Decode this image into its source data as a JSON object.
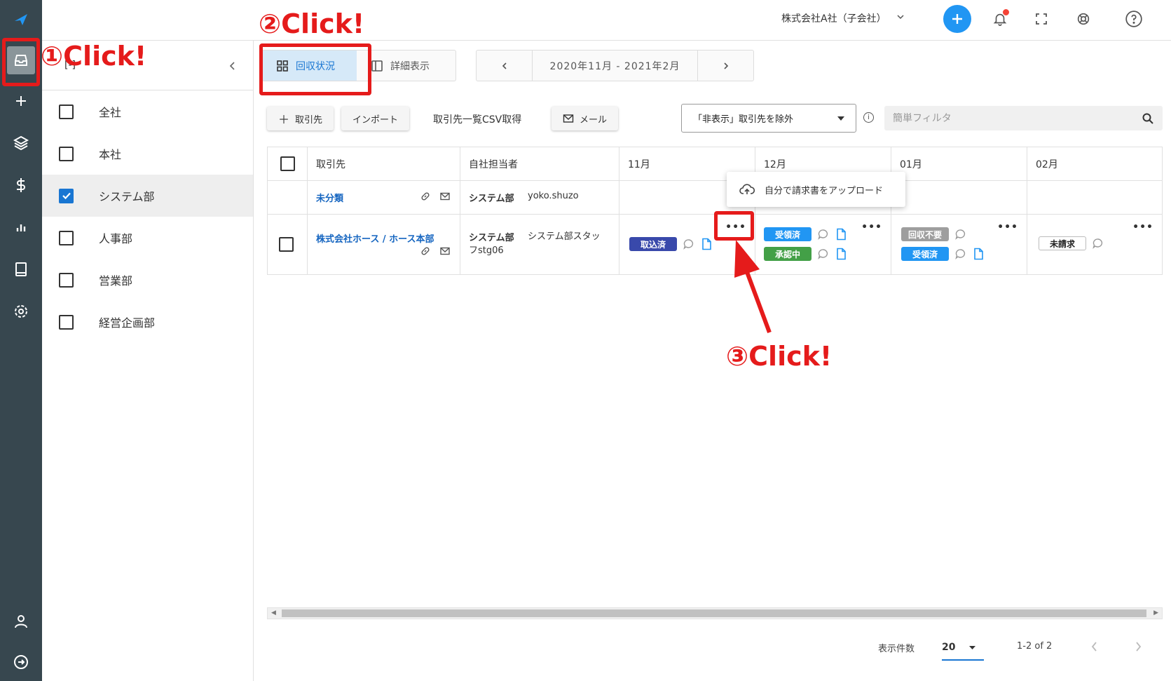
{
  "topbar": {
    "company": "株式会社A社（子会社）"
  },
  "sidebar": {
    "header_label": "[-]",
    "items": [
      {
        "label": "全社",
        "checked": false
      },
      {
        "label": "本社",
        "checked": false
      },
      {
        "label": "システム部",
        "checked": true
      },
      {
        "label": "人事部",
        "checked": false
      },
      {
        "label": "営業部",
        "checked": false
      },
      {
        "label": "経営企画部",
        "checked": false
      }
    ]
  },
  "view": {
    "collection_label": "回収状況",
    "detail_label": "詳細表示"
  },
  "date_range": "2020年11月 - 2021年2月",
  "toolbar": {
    "add_partner": "取引先",
    "import": "インポート",
    "csv": "取引先一覧CSV取得",
    "mail": "メール",
    "filter_select": "「非表示」取引先を除外",
    "search_placeholder": "簡単フィルタ"
  },
  "table": {
    "headers": [
      "取引先",
      "自社担当者",
      "11月",
      "12月",
      "01月",
      "02月"
    ],
    "row1": {
      "partner": "未分類",
      "dept": "システム部",
      "person": "yoko.shuzo"
    },
    "row2": {
      "partner": "株式会社ホース / ホース本部",
      "dept": "システム部",
      "person": "システム部スタッフstg06",
      "nov": [
        "取込済"
      ],
      "dec": [
        "受領済",
        "承認中"
      ],
      "jan": [
        "回収不要",
        "受領済"
      ],
      "feb": [
        "未請求"
      ]
    }
  },
  "popup": {
    "upload_label": "自分で請求書をアップロード"
  },
  "pagination": {
    "per_page_label": "表示件数",
    "per_page": "20",
    "range": "1-2 of 2"
  },
  "annotations": {
    "step1": "①Click!",
    "step2": "②Click!",
    "step3": "③Click!"
  },
  "colors": {
    "rail": "#37474f",
    "accent": "#2196f3",
    "annotation": "#e51b1b",
    "badge_navy": "#3949ab",
    "badge_blue": "#2196f3",
    "badge_green": "#43a047",
    "badge_gray": "#9e9e9e"
  }
}
